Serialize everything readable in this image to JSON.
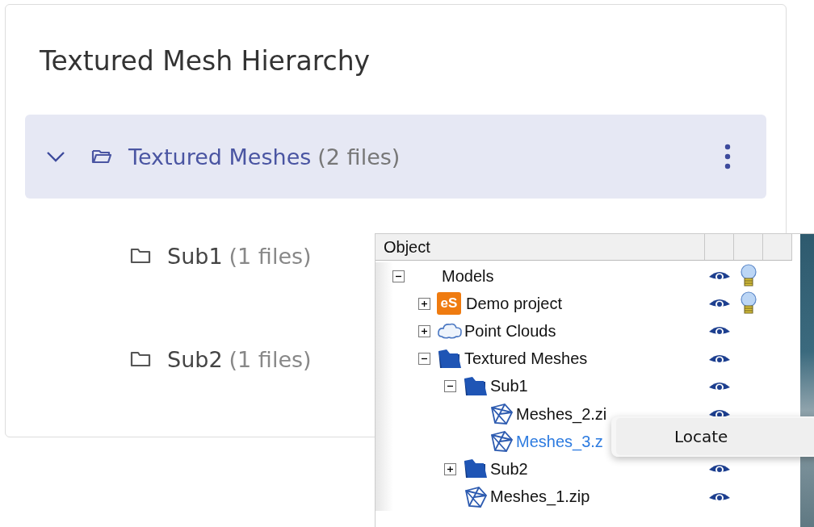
{
  "card": {
    "title": "Textured Mesh Hierarchy",
    "folders": [
      {
        "name": "Textured Meshes",
        "count": "(2 files)",
        "expanded": true,
        "selected": true,
        "children": [
          {
            "name": "Sub1",
            "count": "(1 files)"
          },
          {
            "name": "Sub2",
            "count": "(1 files)"
          }
        ]
      }
    ]
  },
  "tree": {
    "columns": [
      "Object"
    ],
    "items": [
      {
        "name": "Models",
        "expanded": true,
        "visible": true,
        "light": true,
        "selected": false,
        "children": [
          {
            "name": "Demo project",
            "kind": "project",
            "badge": "eS",
            "expanded": false,
            "visible": true,
            "light": true,
            "selected": false
          },
          {
            "name": "Point Clouds",
            "kind": "cloud",
            "expanded": false,
            "visible": true,
            "light": false,
            "selected": false
          },
          {
            "name": "Textured Meshes",
            "kind": "folder",
            "expanded": true,
            "visible": true,
            "light": false,
            "selected": false,
            "children": [
              {
                "name": "Sub1",
                "kind": "folder",
                "expanded": true,
                "visible": true,
                "light": false,
                "selected": false,
                "children": [
                  {
                    "name": "Meshes_2.zi",
                    "kind": "mesh",
                    "visible": true,
                    "light": false,
                    "selected": false
                  },
                  {
                    "name": "Meshes_3.z",
                    "kind": "mesh",
                    "light": false,
                    "selected": true
                  }
                ]
              },
              {
                "name": "Sub2",
                "kind": "folder",
                "expanded": false,
                "visible": true,
                "light": false,
                "selected": false
              },
              {
                "name": "Meshes_1.zip",
                "kind": "mesh",
                "visible": true,
                "light": false,
                "selected": false
              }
            ]
          }
        ]
      }
    ]
  },
  "context_menu": {
    "items": [
      "Locate"
    ]
  }
}
